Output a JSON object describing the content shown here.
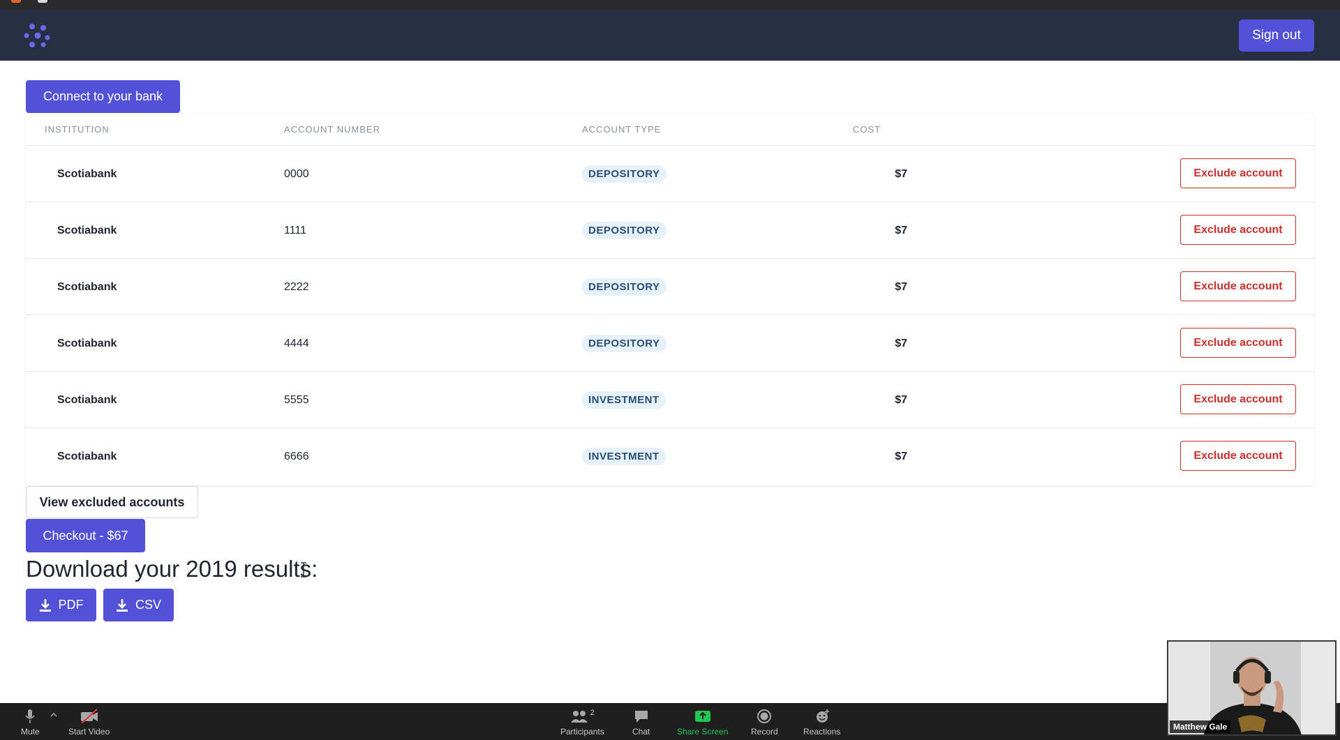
{
  "header": {
    "signout_label": "Sign out"
  },
  "actions": {
    "connect_label": "Connect to your bank",
    "view_excluded_label": "View excluded accounts",
    "checkout_label": "Checkout - $67"
  },
  "table": {
    "columns": [
      "INSTITUTION",
      "ACCOUNT NUMBER",
      "ACCOUNT TYPE",
      "COST"
    ],
    "rows": [
      {
        "institution": "Scotiabank",
        "account_number": "0000",
        "type": "DEPOSITORY",
        "cost": "$7",
        "action": "Exclude account"
      },
      {
        "institution": "Scotiabank",
        "account_number": "1111",
        "type": "DEPOSITORY",
        "cost": "$7",
        "action": "Exclude account"
      },
      {
        "institution": "Scotiabank",
        "account_number": "2222",
        "type": "DEPOSITORY",
        "cost": "$7",
        "action": "Exclude account"
      },
      {
        "institution": "Scotiabank",
        "account_number": "4444",
        "type": "DEPOSITORY",
        "cost": "$7",
        "action": "Exclude account"
      },
      {
        "institution": "Scotiabank",
        "account_number": "5555",
        "type": "INVESTMENT",
        "cost": "$7",
        "action": "Exclude account"
      },
      {
        "institution": "Scotiabank",
        "account_number": "6666",
        "type": "INVESTMENT",
        "cost": "$7",
        "action": "Exclude account"
      }
    ]
  },
  "download": {
    "heading": "Download your 2019 results:",
    "pdf_label": "PDF",
    "csv_label": "CSV"
  },
  "zoom": {
    "mute": "Mute",
    "start_video": "Start Video",
    "participants": "Participants",
    "participants_count": "2",
    "chat": "Chat",
    "share_screen": "Share Screen",
    "record": "Record",
    "reactions": "Reactions",
    "video_name": "Matthew Gale"
  },
  "colors": {
    "primary": "#5451d9",
    "navbar": "#273043",
    "danger": "#c9302c",
    "badge_bg": "#e6f1fa",
    "badge_text": "#2a4e75",
    "share_green": "#23c552"
  }
}
